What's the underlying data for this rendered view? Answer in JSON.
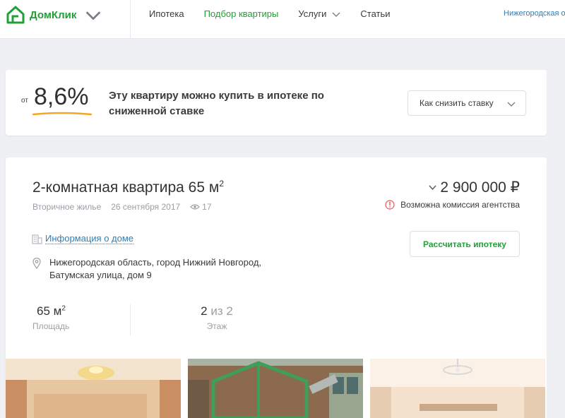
{
  "header": {
    "logo_text": "ДомКлик",
    "nav": [
      {
        "label": "Ипотека",
        "active": false
      },
      {
        "label": "Подбор квартиры",
        "active": true
      },
      {
        "label": "Услуги",
        "active": false,
        "dropdown": true
      },
      {
        "label": "Статьи",
        "active": false
      }
    ],
    "region": "Нижегородская о"
  },
  "promo": {
    "from_label": "от",
    "rate": "8,6%",
    "text": "Эту квартиру можно купить в ипотеке по сниженной ставке",
    "button_label": "Как снизить ставку"
  },
  "listing": {
    "title": "2-комнатная квартира 65 м",
    "title_sup": "2",
    "type": "Вторичное жилье",
    "date": "26 сентября 2017",
    "views": "17",
    "price": "2 900 000 ₽",
    "commission": "Возможна комиссия агентства",
    "house_info_link": "Информация о доме",
    "calc_button": "Рассчитать ипотеку",
    "address": "Нижегородская область, город Нижний Новгород, Батумская улица, дом 9",
    "stats": {
      "area_value": "65 м",
      "area_sup": "2",
      "area_label": "Площадь",
      "floor_value": "2",
      "floor_of": "из 2",
      "floor_label": "Этаж"
    }
  },
  "colors": {
    "brand_green": "#21a038",
    "link_blue": "#2c7fb8",
    "underline_orange": "#f5a623"
  }
}
